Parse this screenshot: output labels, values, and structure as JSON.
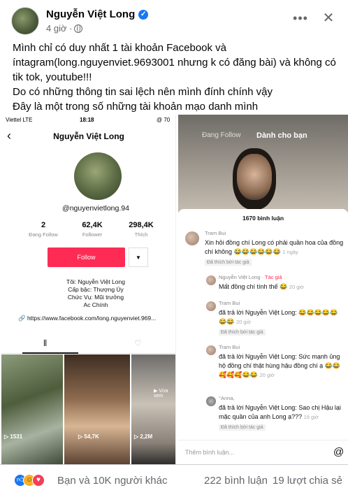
{
  "post": {
    "author": "Nguyễn Việt Long",
    "time": "4 giờ ·",
    "lines": [
      "Mình chỉ có duy nhất 1 tài khoản Facebook và",
      "íntagram(long.nguyenviet.9693001 nhưng k có đăng bài) và không có",
      "tik tok, youtube!!!",
      "Do có những thông tin sai lệch nên mình đính chính vậy",
      "Đây là một trong số những tài khoản mạo danh mình"
    ]
  },
  "left_screenshot": {
    "carrier": "Viettel  LTE",
    "clock": "18:18",
    "battery": "@ 70",
    "profile_name": "Nguyễn Việt Long",
    "handle": "@nguyenvietlong.94",
    "stats": [
      {
        "value": "2",
        "label": "Đang Follow"
      },
      {
        "value": "62,4K",
        "label": "Follower"
      },
      {
        "value": "298,4K",
        "label": "Thích"
      }
    ],
    "follow_label": "Follow",
    "bio_lines": [
      "Tôi: Nguyễn Việt Long",
      "Cấp bậc: Thượng Úy",
      "Chức Vụ: Mũi trưởng",
      "Ac Chính"
    ],
    "link": "https://www.facebook.com/long.nguyenviet.969...",
    "thumb_views": [
      "1531",
      "54,7K",
      "2,2M"
    ],
    "thumb3_caption": "▶ Vừa xem"
  },
  "right_screenshot": {
    "tab_following": "Đang Follow",
    "tab_foryou": "Dành cho bạn",
    "comment_count": "1670 bình luận",
    "comments": [
      {
        "name": "Tram Bui",
        "tag": "",
        "text": "Xin hỏi đồng chí Long có phải quần hoa của đồng chí không 😂😂😂😂😂😂",
        "time": "1 ngày",
        "liked": "Đã thích bởi tác giả"
      },
      {
        "name": "Nguyễn Việt Long · ",
        "tag": "Tác giả",
        "text": "Mất đồng chí tính thế 😂",
        "time": "20 giờ",
        "liked": ""
      },
      {
        "name": "Tram Bui",
        "tag": "",
        "text": "đã trả lời Nguyễn Việt Long: 😂😂😂😂😂😂😂",
        "time": "20 giờ",
        "liked": "Đã thích bởi tác giả"
      },
      {
        "name": "Tram Bui",
        "tag": "",
        "text": "đã trả lời Nguyễn Việt Long: Sức mạnh ủng hộ đồng chí thật hùng hậu đồng chí ạ 😂😂🥰🥰🥰😂😂",
        "time": "20 giờ",
        "liked": ""
      },
      {
        "name": "°Anna,",
        "tag": "",
        "text": "đã trả lời Nguyễn Việt Long: Sao chị Hậu lại mặc quần của anh Long ạ???",
        "time": "19 giờ",
        "liked": "Đã thích bởi tác giả"
      }
    ],
    "add_comment_placeholder": "Thêm bình luận...",
    "at_symbol": "@"
  },
  "footer": {
    "reactions_text": "Bạn và 10K người khác",
    "comments": "222 bình luận",
    "shares": "19 lượt chia sẻ"
  },
  "icons": [
    "verified-icon",
    "globe-icon",
    "more-icon",
    "close-icon",
    "like-reaction-icon",
    "haha-reaction-icon",
    "love-reaction-icon"
  ],
  "colors": {
    "facebook_blue": "#1877f2",
    "tiktok_red": "#fe2c55",
    "meta_gray": "#65676b"
  }
}
